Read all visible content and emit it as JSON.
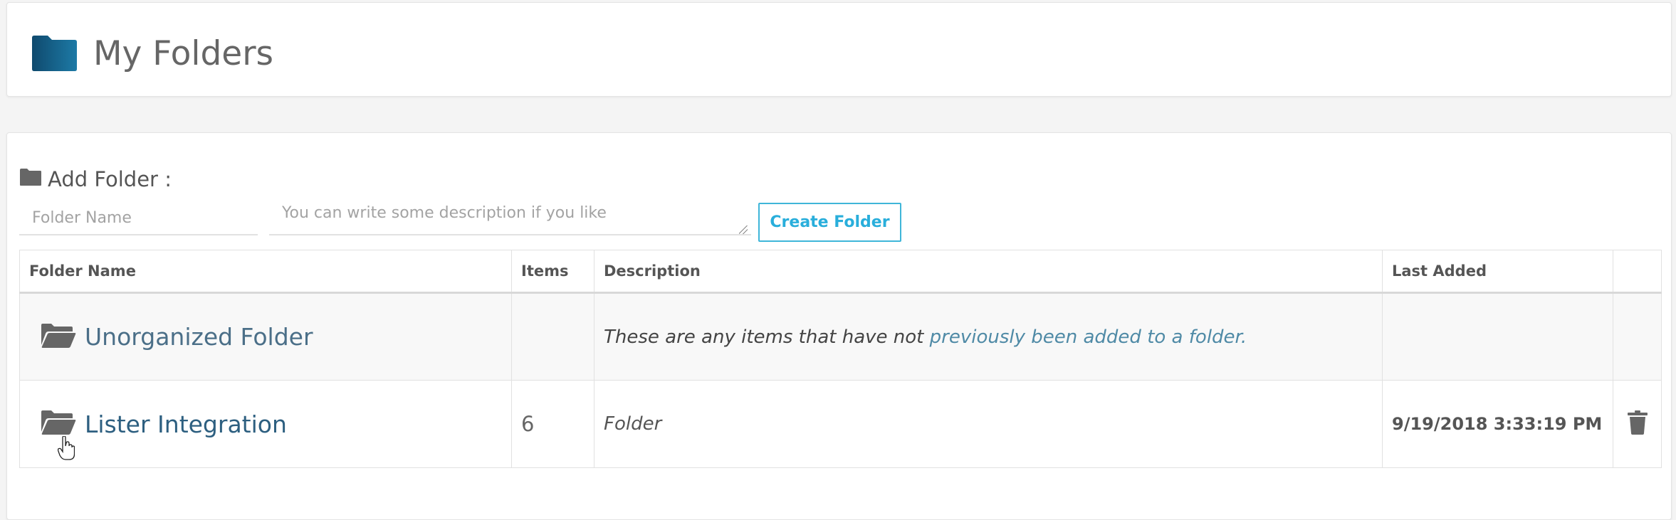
{
  "header": {
    "title": "My Folders",
    "icon": "folder-icon",
    "icon_colors": [
      "#1d6f9a",
      "#0c3d5c"
    ]
  },
  "add_folder": {
    "label": "Add Folder :",
    "folder_name_placeholder": "Folder Name",
    "folder_name_value": "",
    "description_placeholder": "You can write some description if you like",
    "description_value": "",
    "create_button_label": "Create Folder"
  },
  "table": {
    "columns": [
      "Folder Name",
      "Items",
      "Description",
      "Last Added",
      ""
    ],
    "rows": [
      {
        "name": "Unorganized Folder",
        "items": "",
        "description_part1": "These are any items that have not",
        "description_part2": " previously been added to a folder.",
        "last_added": "",
        "icon": "folder-open-icon"
      },
      {
        "name": "Lister Integration",
        "items": "6",
        "description": "Folder",
        "last_added": "9/19/2018 3:33:19 PM",
        "icon": "folder-open-icon",
        "delete_icon": "trash-icon"
      }
    ]
  },
  "colors": {
    "accent": "#29aedb",
    "link": "#2d5f80",
    "link_muted": "#4b6f88"
  }
}
